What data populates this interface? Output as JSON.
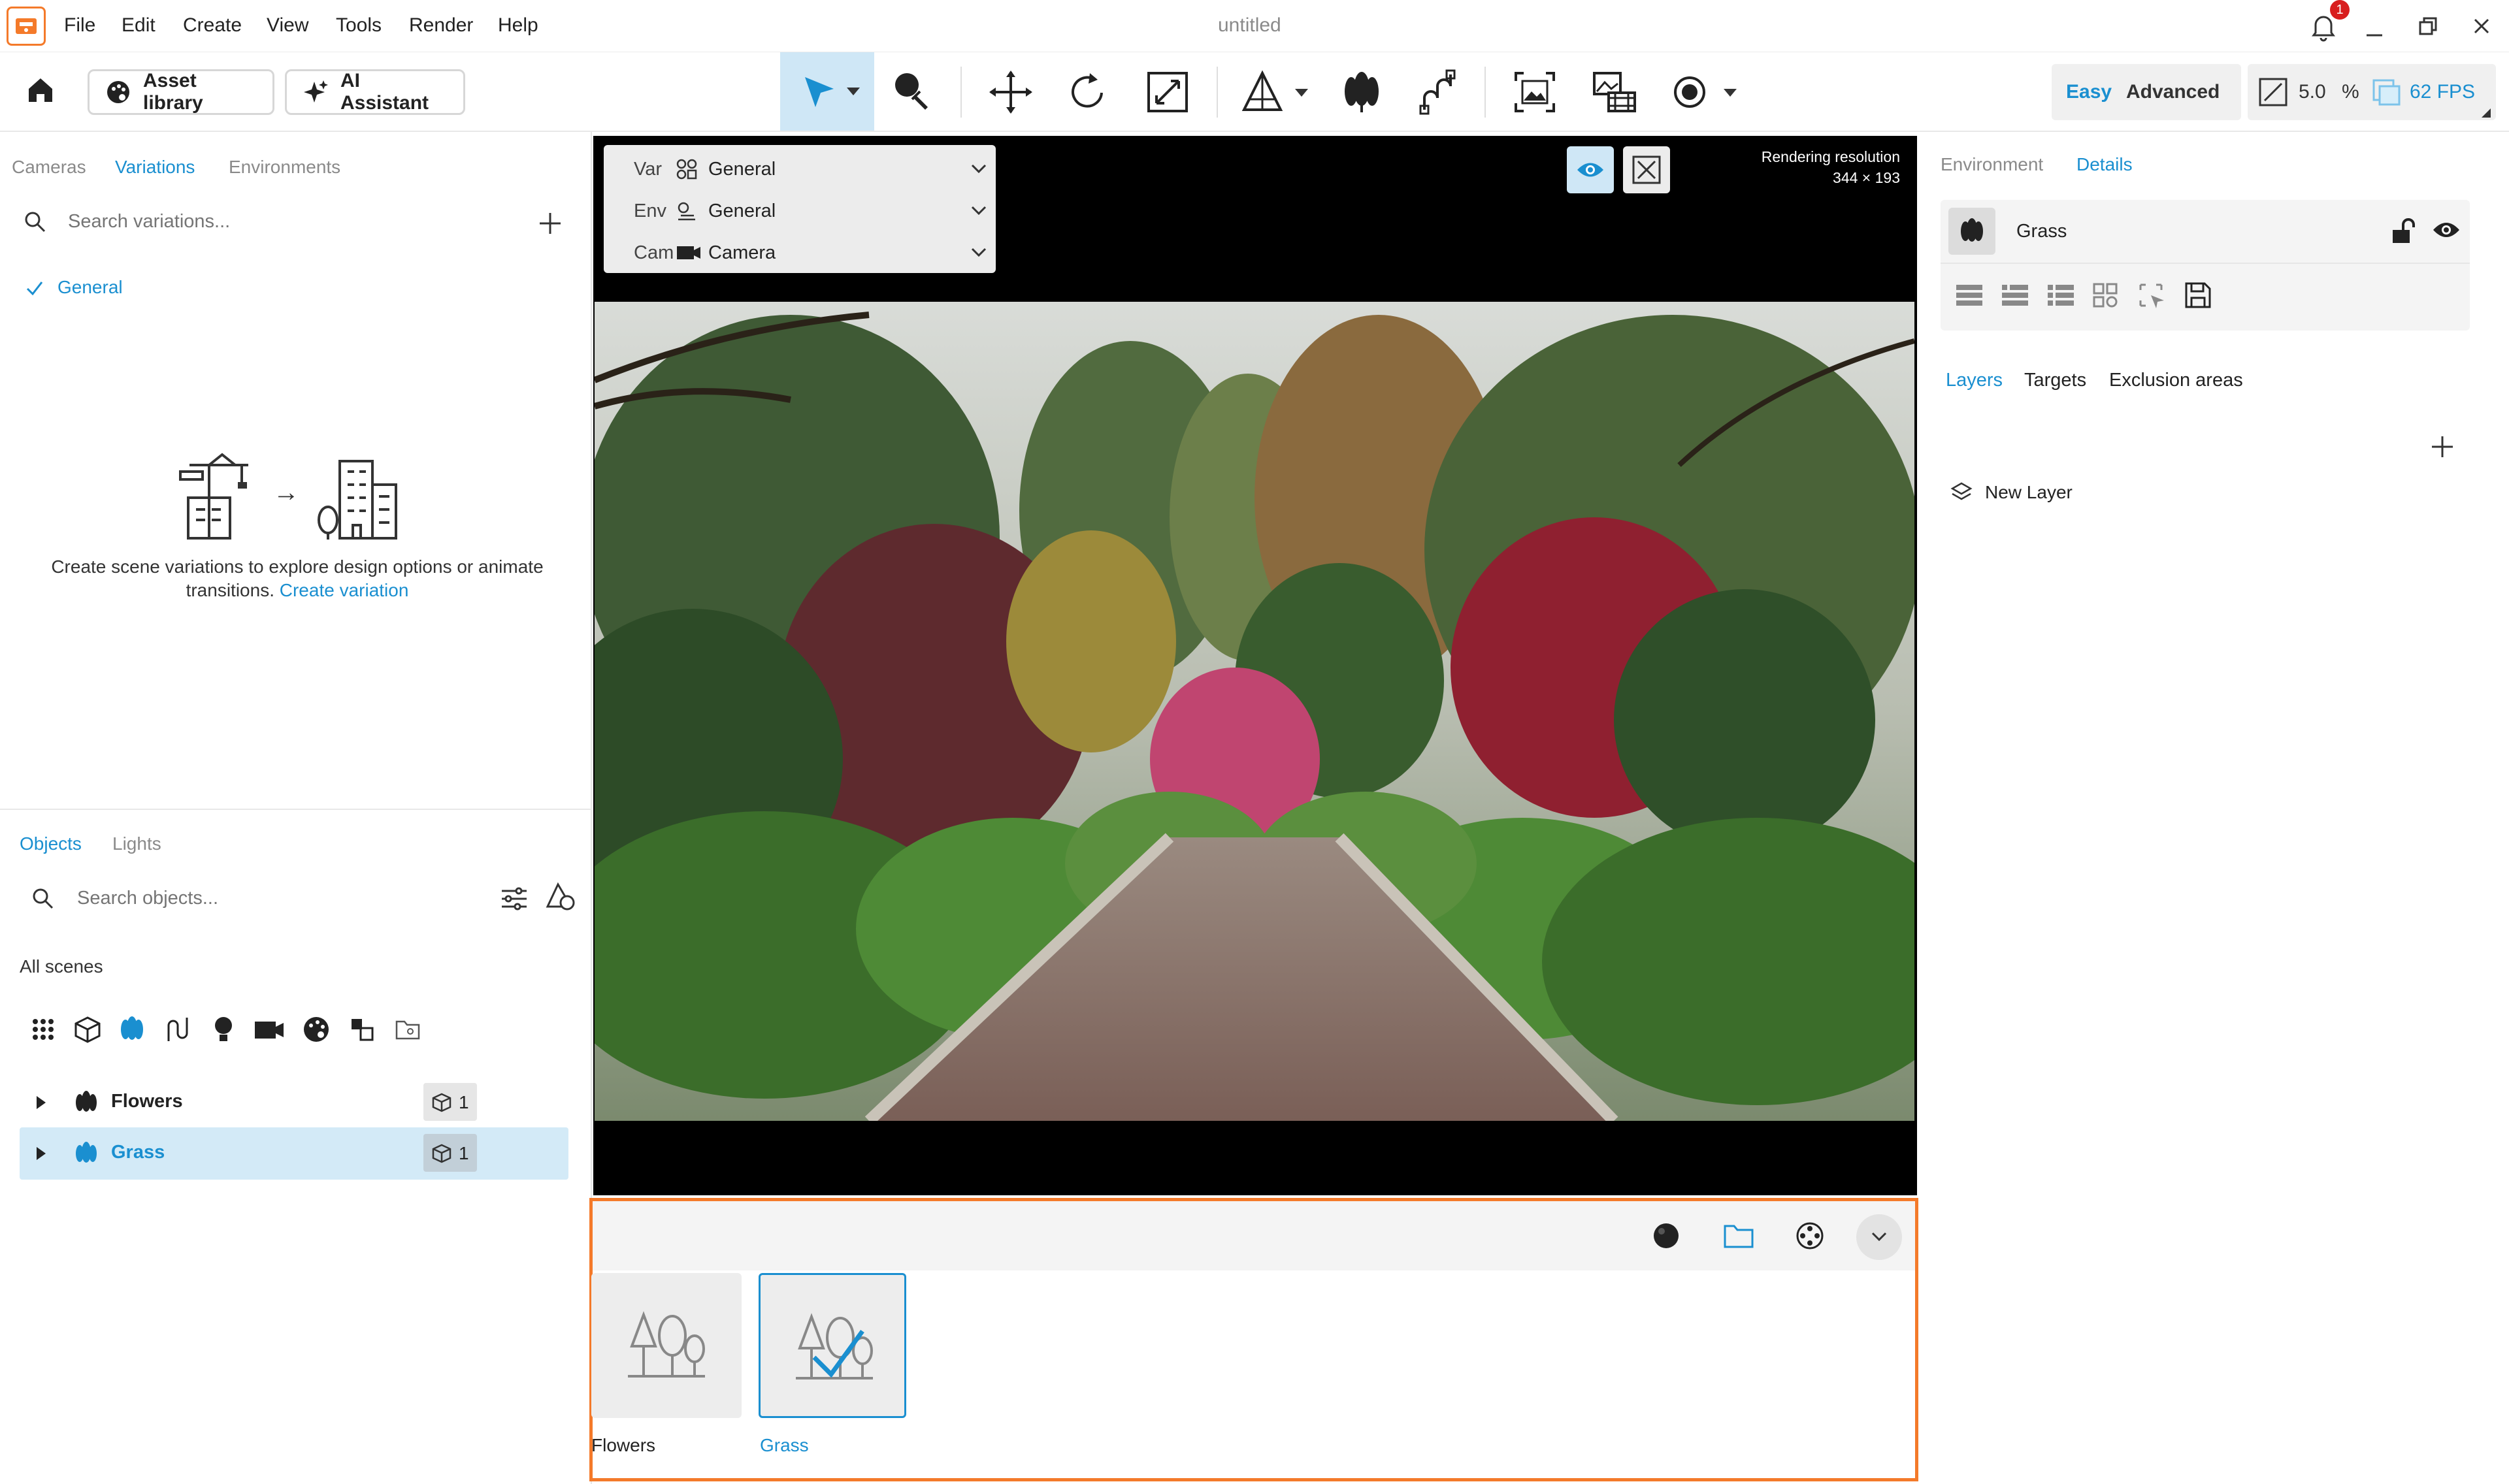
{
  "app": {
    "title": "untitled",
    "menu": [
      "File",
      "Edit",
      "Create",
      "View",
      "Tools",
      "Render",
      "Help"
    ],
    "notification_count": "1",
    "icons": {
      "logo": "app-logo-icon",
      "bell": "bell-icon",
      "minimize": "minimize-icon",
      "restore": "restore-icon",
      "close": "close-icon"
    }
  },
  "toolbar": {
    "asset_library_label": "Asset library",
    "ai_assistant_label": "AI Assistant",
    "mode_easy": "Easy",
    "mode_advanced": "Advanced",
    "resolution_percent": "5.0",
    "percent_sign": "%",
    "fps": "62 FPS",
    "accent": "#1a8fd0",
    "tools": [
      "select-tool",
      "paint-tool",
      "move-tool",
      "rotate-tool",
      "scale-tool",
      "place-tool",
      "scatter-tool",
      "path-tool",
      "screenshot-tool",
      "media-tool",
      "record-tool"
    ]
  },
  "left": {
    "tabs_top": [
      "Cameras",
      "Variations",
      "Environments"
    ],
    "active_top": "Variations",
    "search_variations_placeholder": "Search variations...",
    "variation_item": "General",
    "empty_text": "Create scene variations to explore design options or animate transitions.",
    "empty_link": "Create variation",
    "arrow": "→",
    "tabs_bottom": [
      "Objects",
      "Lights"
    ],
    "active_bottom": "Objects",
    "search_objects_placeholder": "Search objects...",
    "scope_label": "All scenes",
    "filter_icons": [
      "grid-icon",
      "cube-icon",
      "vegetation-icon",
      "path-icon",
      "light-icon",
      "camera-icon",
      "material-icon",
      "transform-icon",
      "folder-icon"
    ],
    "objects": [
      {
        "name": "Flowers",
        "count": "1",
        "selected": false
      },
      {
        "name": "Grass",
        "count": "1",
        "selected": true
      }
    ]
  },
  "viewport": {
    "var_label": "Var",
    "var_value": "General",
    "env_label": "Env",
    "env_value": "General",
    "cam_label": "Cam",
    "cam_value": "Camera",
    "rendering_label": "Rendering resolution",
    "rendering_value": "344 × 193"
  },
  "right": {
    "tabs": [
      "Environment",
      "Details"
    ],
    "active_tab": "Details",
    "layer_group_name": "Grass",
    "subtabs": [
      "Layers",
      "Targets",
      "Exclusion areas"
    ],
    "active_subtab": "Layers",
    "new_layer_label": "New Layer"
  },
  "asset_panel": {
    "items": [
      {
        "label": "Flowers",
        "selected": false
      },
      {
        "label": "Grass",
        "selected": true
      }
    ],
    "border_color": "#f47a2a"
  }
}
